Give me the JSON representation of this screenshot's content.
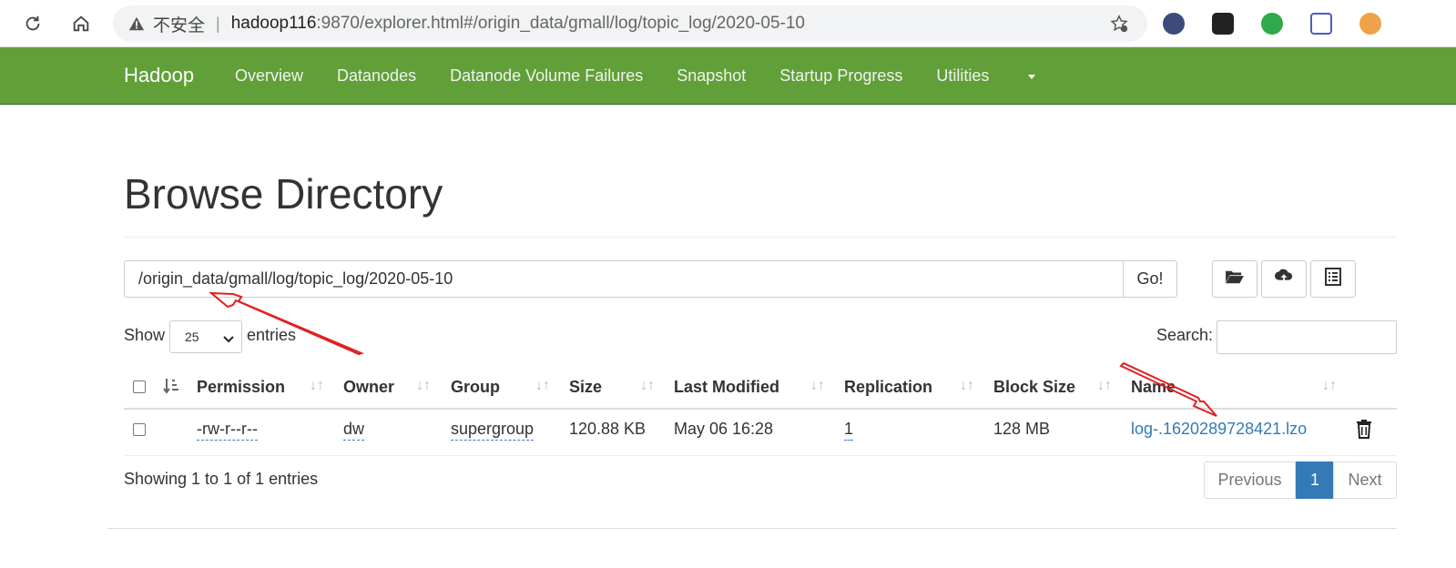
{
  "browser": {
    "insecure_label": "不安全",
    "separator": "|",
    "url_host": "hadoop116",
    "url_rest": ":9870/explorer.html#/origin_data/gmall/log/topic_log/2020-05-10"
  },
  "navbar": {
    "brand": "Hadoop",
    "items": [
      "Overview",
      "Datanodes",
      "Datanode Volume Failures",
      "Snapshot",
      "Startup Progress",
      "Utilities"
    ],
    "color": "#61a038"
  },
  "page": {
    "title": "Browse Directory",
    "path_value": "/origin_data/gmall/log/topic_log/2020-05-10",
    "go_label": "Go!",
    "show_label": "Show",
    "entries_value": "25",
    "entries_label": "entries",
    "search_label": "Search:",
    "showing_text": "Showing 1 to 1 of 1 entries"
  },
  "table": {
    "columns": [
      "Permission",
      "Owner",
      "Group",
      "Size",
      "Last Modified",
      "Replication",
      "Block Size",
      "Name"
    ],
    "rows": [
      {
        "permission": "-rw-r--r--",
        "owner": "dw",
        "group": "supergroup",
        "size": "120.88 KB",
        "last_modified": "May 06 16:28",
        "replication": "1",
        "block_size": "128 MB",
        "name": "log-.1620289728421.lzo"
      }
    ]
  },
  "pagination": {
    "previous": "Previous",
    "current": "1",
    "next": "Next"
  },
  "icons": [
    "reload-icon",
    "home-icon",
    "warning-icon",
    "bookmark-star-icon",
    "folder-open-icon",
    "upload-cloud-icon",
    "list-icon",
    "trash-icon",
    "sort-icon"
  ]
}
